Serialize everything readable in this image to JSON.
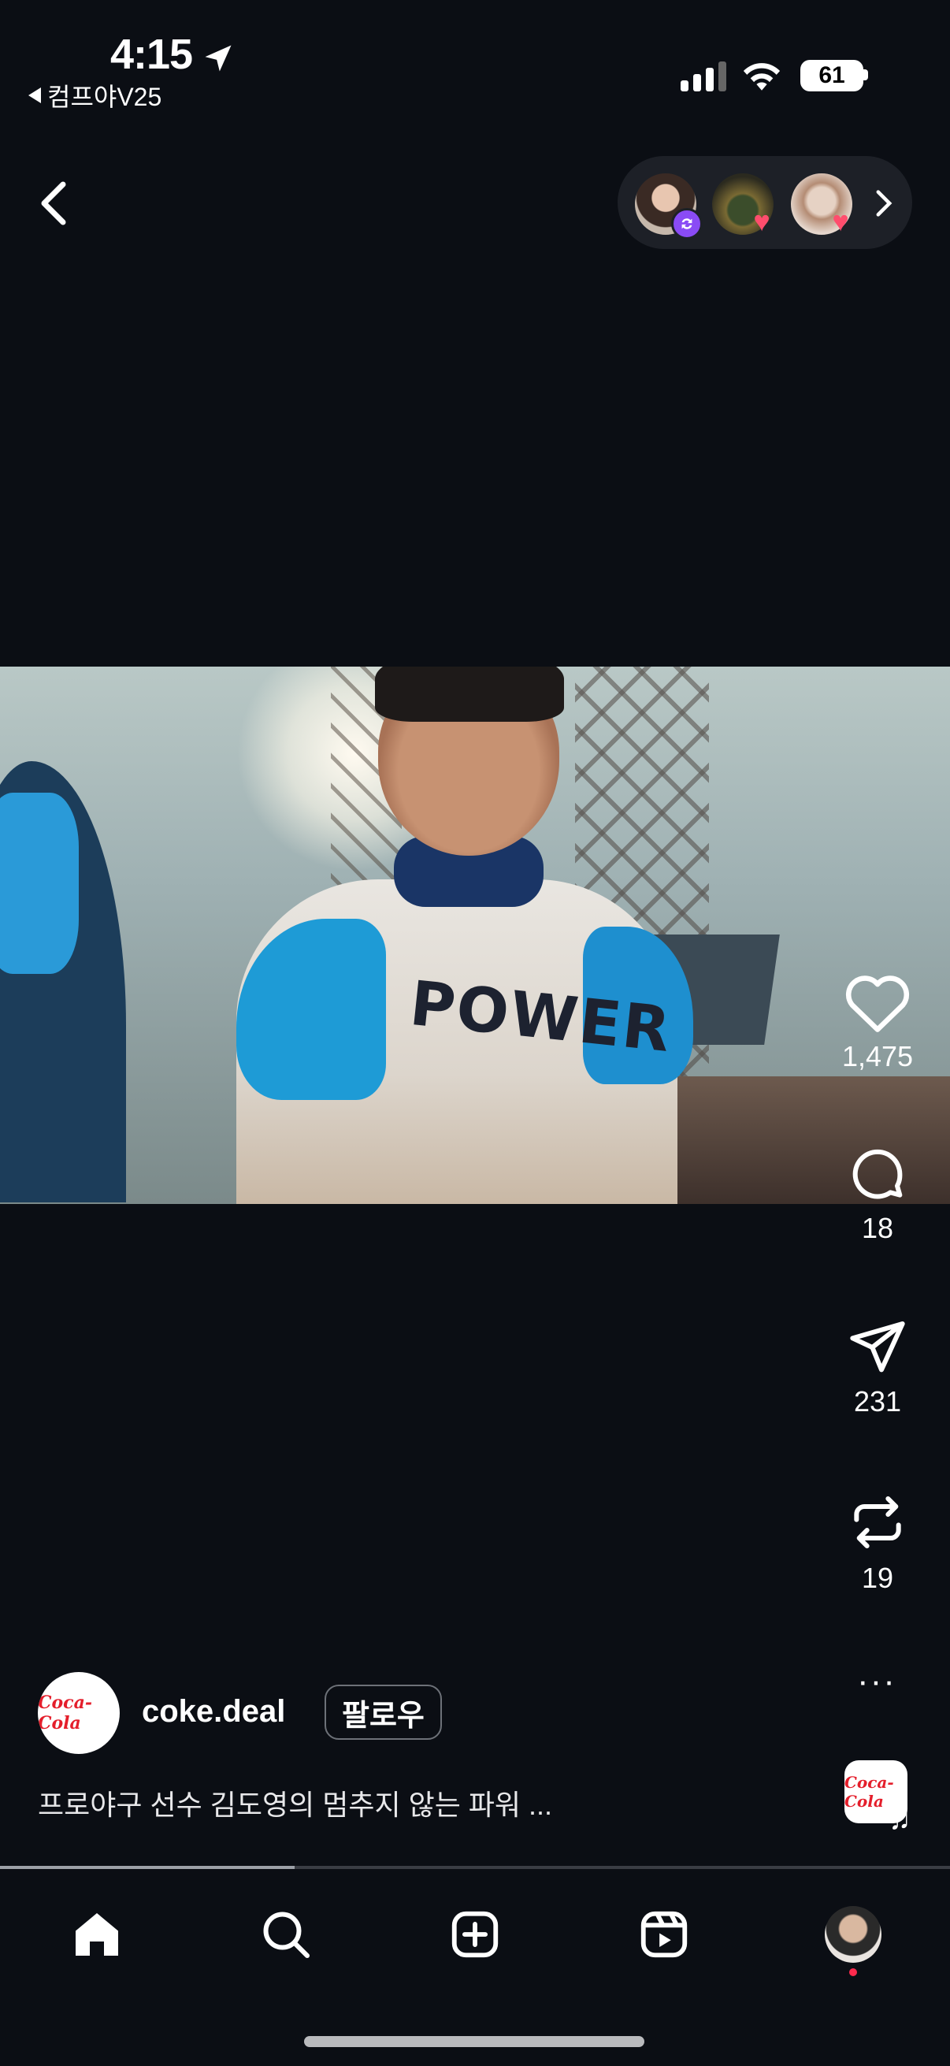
{
  "status_bar": {
    "time": "4:15",
    "back_app": "컴프야V25",
    "battery": "61"
  },
  "header": {
    "back_icon": "chevron-left-icon",
    "viewers": [
      {
        "badge": "repost-icon",
        "badge_color": "#8a4bf5"
      },
      {
        "badge": "heart-icon",
        "badge_color": "#ff4d6d"
      },
      {
        "badge": "heart-icon",
        "badge_color": "#ff4d6d"
      }
    ]
  },
  "actions": {
    "like_count": "1,475",
    "comment_count": "18",
    "share_count": "231",
    "repost_count": "19",
    "more": "···"
  },
  "post": {
    "author": "coke.deal",
    "avatar_logo": "Coca-Cola",
    "follow_label": "팔로우",
    "caption": "프로야구 선수 김도영의 멈추지 않는 파워 ...",
    "video_jersey_text": "POWER",
    "progress_fraction": 0.31
  },
  "nav": [
    "home-icon",
    "search-icon",
    "create-icon",
    "reels-icon",
    "profile-avatar"
  ],
  "colors": {
    "background": "#0b0e14",
    "accent_red": "#e41e2b",
    "notification_dot": "#ff2a4d"
  }
}
